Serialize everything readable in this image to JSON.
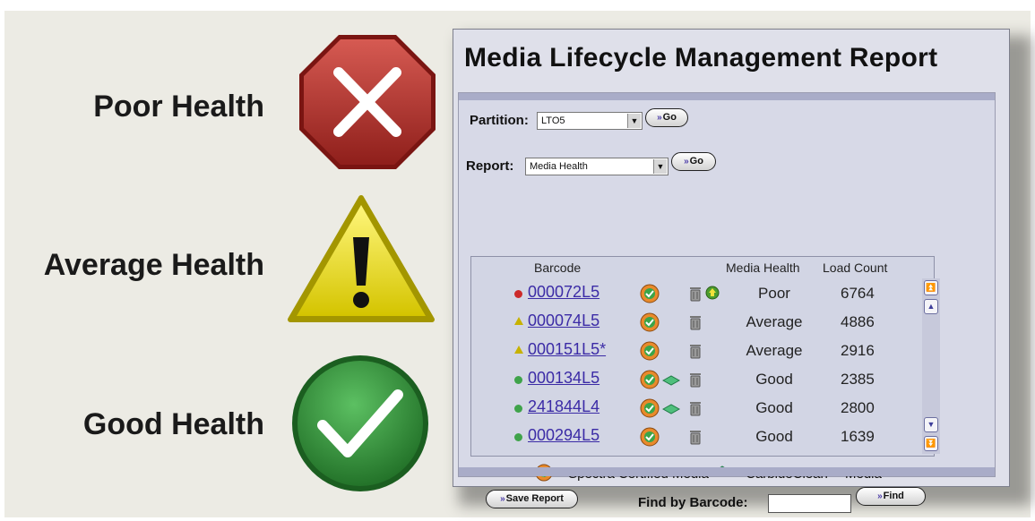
{
  "legend": {
    "poor": {
      "label": "Poor Health",
      "icon": "poor-health-stop-icon",
      "color": "#b8322c"
    },
    "average": {
      "label": "Average Health",
      "icon": "average-health-warning-icon",
      "color": "#e3d200"
    },
    "good": {
      "label": "Good Health",
      "icon": "good-health-check-icon",
      "color": "#2f8d36"
    }
  },
  "report": {
    "title": "Media Lifecycle Management Report",
    "partition": {
      "label": "Partition:",
      "value": "LTO5",
      "go_label": "Go"
    },
    "report_select": {
      "label": "Report:",
      "value": "Media Health",
      "go_label": "Go"
    },
    "table": {
      "headers": {
        "barcode": "Barcode",
        "health": "Media Health",
        "load_count": "Load Count"
      },
      "rows": [
        {
          "status": "poor",
          "barcode": "000072L5",
          "certified": true,
          "carbide": false,
          "trash": true,
          "eject": true,
          "health": "Poor",
          "load_count": "6764"
        },
        {
          "status": "average",
          "barcode": "000074L5",
          "certified": true,
          "carbide": false,
          "trash": true,
          "eject": false,
          "health": "Average",
          "load_count": "4886"
        },
        {
          "status": "average",
          "barcode": "000151L5*",
          "certified": true,
          "carbide": false,
          "trash": true,
          "eject": false,
          "health": "Average",
          "load_count": "2916"
        },
        {
          "status": "good",
          "barcode": "000134L5",
          "certified": true,
          "carbide": true,
          "trash": true,
          "eject": false,
          "health": "Good",
          "load_count": "2385"
        },
        {
          "status": "good",
          "barcode": "241844L4",
          "certified": true,
          "carbide": true,
          "trash": true,
          "eject": false,
          "health": "Good",
          "load_count": "2800"
        },
        {
          "status": "good",
          "barcode": "000294L5",
          "certified": true,
          "carbide": false,
          "trash": true,
          "eject": false,
          "health": "Good",
          "load_count": "1639"
        }
      ]
    },
    "footnote": {
      "certified_text": "= Spectra Certified Media",
      "carbide_text": "= CarbideClean™ Media"
    },
    "save_report_label": "Save Report",
    "find": {
      "label": "Find by Barcode:",
      "value": "",
      "button_label": "Find"
    }
  }
}
